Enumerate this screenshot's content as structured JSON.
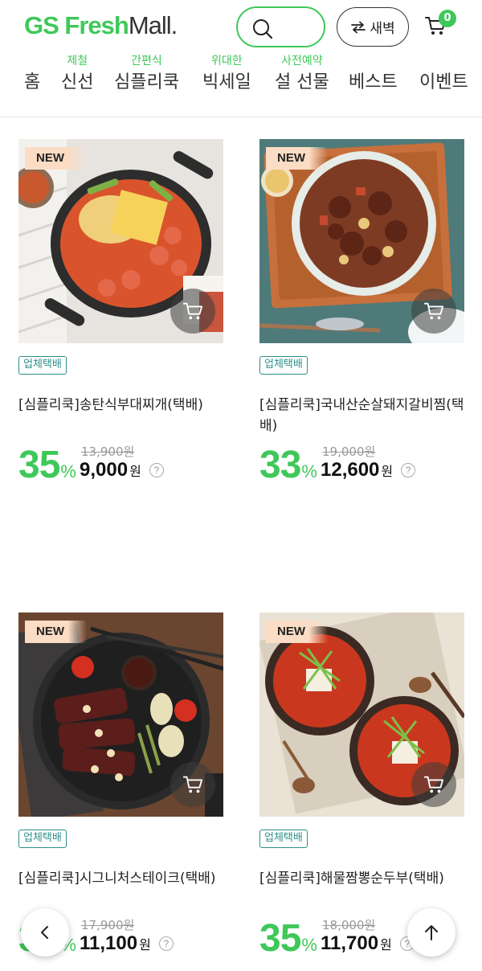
{
  "header": {
    "logo_gs": "GS",
    "logo_fresh": "Fresh",
    "logo_mall": "Mall.",
    "dawn_label": "새벽",
    "cart_count": "0"
  },
  "nav": [
    {
      "sub": "",
      "label": "홈"
    },
    {
      "sub": "제철",
      "label": "신선"
    },
    {
      "sub": "간편식",
      "label": "심플리쿡"
    },
    {
      "sub": "위대한",
      "label": "빅세일"
    },
    {
      "sub": "사전예약",
      "label": "설 선물"
    },
    {
      "sub": "",
      "label": "베스트"
    },
    {
      "sub": "",
      "label": "이벤트"
    }
  ],
  "products": [
    {
      "tag": "NEW",
      "badge": "업체택배",
      "name": "[심플리쿡]송탄식부대찌개(택배)",
      "discount": "35",
      "pct": "%",
      "original": "13,900원",
      "sale": "9,000",
      "unit": "원",
      "help": "?"
    },
    {
      "tag": "NEW",
      "badge": "업체택배",
      "name": "[심플리쿡]국내산순살돼지갈비찜(택배)",
      "discount": "33",
      "pct": "%",
      "original": "19,000원",
      "sale": "12,600",
      "unit": "원",
      "help": "?"
    },
    {
      "tag": "NEW",
      "badge": "업체택배",
      "name": "[심플리쿡]시그니처스테이크(택배)",
      "discount": "37",
      "pct": "%",
      "original": "17,900원",
      "sale": "11,100",
      "unit": "원",
      "help": "?"
    },
    {
      "tag": "NEW",
      "badge": "업체택배",
      "name": "[심플리쿡]해물짬뽕순두부(택배)",
      "discount": "35",
      "pct": "%",
      "original": "18,000원",
      "sale": "11,700",
      "unit": "원",
      "help": "?"
    }
  ],
  "colors": {
    "accent": "#3fc85a",
    "badge": "#2e8f8a",
    "new_tag": "#fbdcc4"
  },
  "icons": {
    "search": "search-icon",
    "swap": "swap-arrows-icon",
    "cart": "cart-icon",
    "back": "chevron-left-icon",
    "top": "arrow-up-icon"
  }
}
